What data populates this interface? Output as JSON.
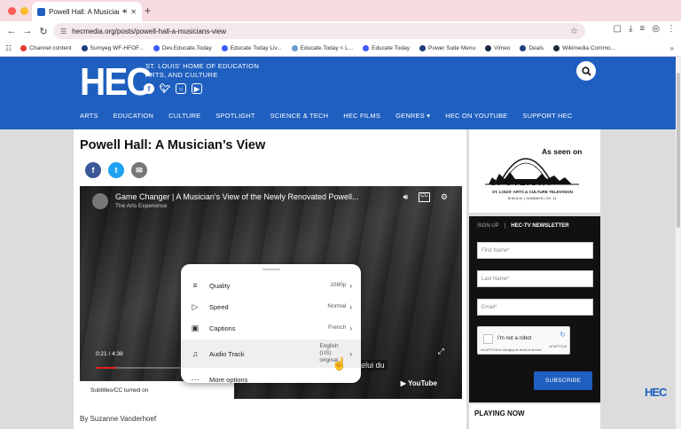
{
  "browser": {
    "tab_title": "Powell Hall: A Musician's",
    "tab_audio_icon": "speaker-icon",
    "url": "hecmedia.org/posts/powell-hall-a-musicians-view",
    "bookmarks": [
      {
        "label": "Channel content",
        "color": "#e53935"
      },
      {
        "label": "Sumyeg WF-HFOF...",
        "color": "#1f3f7f"
      },
      {
        "label": "Dev.Educate.Today",
        "color": "#3d5afe"
      },
      {
        "label": "Educate Today Liv...",
        "color": "#3d5afe"
      },
      {
        "label": "Educate.Today < L...",
        "color": "#6b9bd1"
      },
      {
        "label": "Educate Today",
        "color": "#3d5afe"
      },
      {
        "label": "Power Suite Menu",
        "color": "#1f3f7f"
      },
      {
        "label": "Vimeo",
        "color": "#1a2b3c"
      },
      {
        "label": "Deals",
        "color": "#1f3f7f"
      },
      {
        "label": "Wikimedia Commo...",
        "color": "#1a2b3c"
      }
    ]
  },
  "site": {
    "logo": "HEC",
    "tagline_1": "ST. LOUIS' HOME OF EDUCATION",
    "tagline_2": "ARTS, AND CULTURE",
    "brand_color": "#1f5fbf",
    "nav": [
      "ARTS",
      "EDUCATION",
      "CULTURE",
      "SPOTLIGHT",
      "SCIENCE & TECH",
      "HEC FILMS",
      "GENRES ▾",
      "HEC ON YOUTUBE",
      "SUPPORT HEC"
    ]
  },
  "article": {
    "title": "Powell Hall: A Musician’s View",
    "byline": "By Suzanne Vanderhoef"
  },
  "video": {
    "title": "Game Changer | A Musician's View of the Newly Renovated Powell...",
    "channel": "The Arts Experience",
    "cc_label": "CC",
    "time": "0:21 / 4:38",
    "progress": 0.076,
    "caption_text": "dans le            en collaboration appelant celui du",
    "youtube_label": "▶ YouTube",
    "subtitles_toast": "Subtitles/CC turned on",
    "settings": [
      {
        "label": "Quality",
        "value": "1080p",
        "icon": "sliders-icon",
        "glyph": "≡"
      },
      {
        "label": "Speed",
        "value": "Normal",
        "icon": "speed-icon",
        "glyph": "▷"
      },
      {
        "label": "Captions",
        "value": "French",
        "icon": "captions-icon",
        "glyph": "▣"
      },
      {
        "label": "Audio Track",
        "value": "English (US) original",
        "icon": "audio-track-icon",
        "glyph": "♫"
      },
      {
        "label": "More options",
        "value": "",
        "icon": "more-icon",
        "glyph": "⋯"
      }
    ]
  },
  "sidebar": {
    "as_seen_on": "As seen on",
    "spotlight": "SPOTLIGHT",
    "spotlight_sub": "ST. LOUIS' ARTS & CULTURE TELEVISION",
    "spotlight_time": "8:30 A.M. | SUNDAYS | CH. 11",
    "signup": "SIGN UP",
    "newsletter": "HEC-TV NEWSLETTER",
    "first_name_placeholder": "First Name*",
    "last_name_placeholder": "Last Name*",
    "email_placeholder": "Email*",
    "captcha_label": "I'm not a robot",
    "captcha_brand": "reCAPTCHA",
    "captcha_terms": "reCAPTCHA is changing its terms of service",
    "subscribe": "SUBSCRIBE",
    "playing_now": "PLAYING NOW"
  },
  "corner_logo": "HEC"
}
